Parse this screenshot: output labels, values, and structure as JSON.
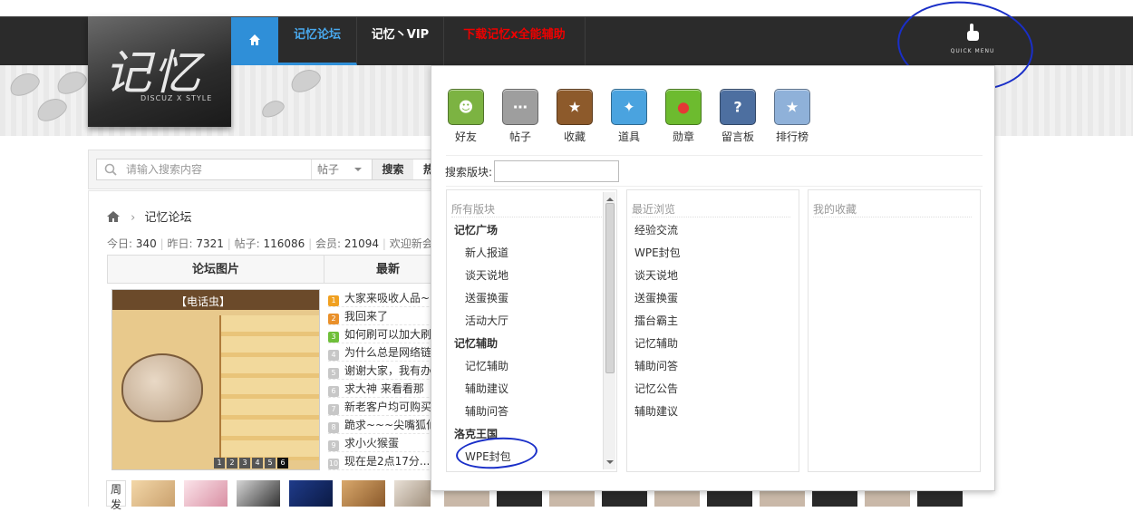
{
  "nav": {
    "logo_text": "记忆",
    "logo_sub": "DISCUZ X STYLE",
    "items": [
      "记忆论坛",
      "记忆丶VIP",
      "下载记忆ⅹ全能辅助"
    ],
    "quick_menu": "QUICK MENU",
    "accent": "#2f8fd8"
  },
  "search": {
    "placeholder": "请输入搜索内容",
    "scope": "帖子",
    "button": "搜索",
    "hot": "热"
  },
  "breadcrumb": {
    "current": "记忆论坛"
  },
  "stats": {
    "today_label": "今日:",
    "today": "340",
    "yesterday_label": "昨日:",
    "yesterday": "7321",
    "posts_label": "帖子:",
    "posts": "116086",
    "members_label": "会员:",
    "members": "21094",
    "welcome": "欢迎新会员"
  },
  "table": {
    "pic_header": "论坛图片",
    "news_header": "最新",
    "pic_title": "【电话虫】",
    "pager": [
      "1",
      "2",
      "3",
      "4",
      "5",
      "6"
    ],
    "news": [
      {
        "n": "1",
        "t": "大家来吸收人品~"
      },
      {
        "n": "2",
        "t": "我回来了"
      },
      {
        "n": "3",
        "t": "如何刷可以加大刷"
      },
      {
        "n": "4",
        "t": "为什么总是网络链"
      },
      {
        "n": "5",
        "t": "谢谢大家，我有办"
      },
      {
        "n": "6",
        "t": "求大神 来看看那"
      },
      {
        "n": "7",
        "t": "新老客户均可购买"
      },
      {
        "n": "8",
        "t": "跪求~~~尖嘴狐仙"
      },
      {
        "n": "9",
        "t": "求小火猴蛋"
      },
      {
        "n": "10",
        "t": "现在是2点17分..."
      }
    ]
  },
  "avatars": {
    "week_label": "周发"
  },
  "quick_menu": {
    "tools": [
      {
        "label": "好友",
        "icon": "friends-icon",
        "color": "#7cb342"
      },
      {
        "label": "帖子",
        "icon": "post-icon",
        "color": "#9e9e9e"
      },
      {
        "label": "收藏",
        "icon": "star-icon",
        "color": "#8d5a2b"
      },
      {
        "label": "道具",
        "icon": "wand-icon",
        "color": "#4aa3df"
      },
      {
        "label": "勋章",
        "icon": "medal-icon",
        "color": "#6dbb2f"
      },
      {
        "label": "留言板",
        "icon": "guestbook-icon",
        "color": "#4d6fa0"
      },
      {
        "label": "排行榜",
        "icon": "ranking-icon",
        "color": "#8fb1d9"
      }
    ],
    "forum_search_label": "搜索版块:",
    "all_forums": {
      "header": "所有版块",
      "items": [
        {
          "label": "记忆广场",
          "group": true
        },
        {
          "label": "新人报道",
          "group": false
        },
        {
          "label": "谈天说地",
          "group": false
        },
        {
          "label": "送蛋换蛋",
          "group": false
        },
        {
          "label": "活动大厅",
          "group": false
        },
        {
          "label": "记忆辅助",
          "group": true
        },
        {
          "label": "记忆辅助",
          "group": false
        },
        {
          "label": "辅助建议",
          "group": false
        },
        {
          "label": "辅助问答",
          "group": false
        },
        {
          "label": "洛克王国",
          "group": true
        },
        {
          "label": "WPE封包",
          "group": false
        }
      ]
    },
    "recent": {
      "header": "最近浏览",
      "items": [
        "经验交流",
        "WPE封包",
        "谈天说地",
        "送蛋换蛋",
        "擂台霸主",
        "记忆辅助",
        "辅助问答",
        "记忆公告",
        "辅助建议"
      ]
    },
    "favorites": {
      "header": "我的收藏"
    }
  }
}
